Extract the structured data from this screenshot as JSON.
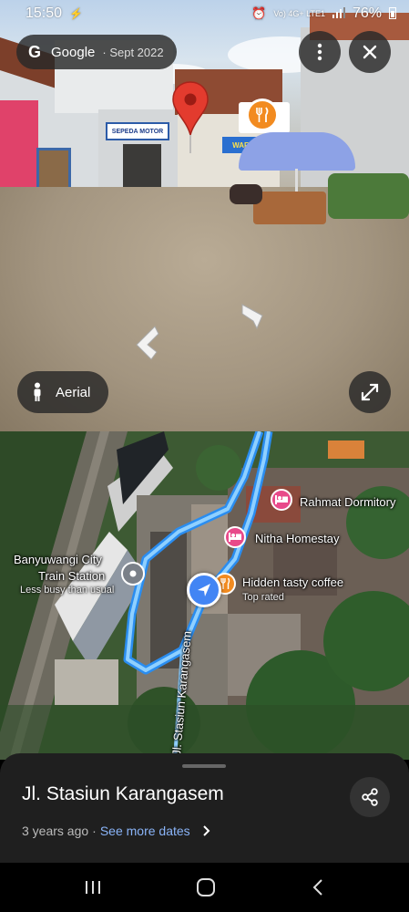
{
  "status_bar": {
    "time": "15:50",
    "network": "Vo) 4G+ LTE1",
    "battery": "76%"
  },
  "street_view": {
    "provider": "Google",
    "capture_date": "Sept 2022",
    "aerial_label": "Aerial",
    "sign_text": "SEPEDA MOTOR",
    "warung_text": "WARUNG PR",
    "icons": {
      "more": "more-vert-icon",
      "close": "close-icon",
      "expand": "expand-icon",
      "person": "person-icon",
      "pin": "red-location-pin-icon",
      "restaurant": "restaurant-icon"
    }
  },
  "map": {
    "places": [
      {
        "name": "Banyuwangi City Train Station",
        "line1": "Banyuwangi City",
        "line2": "Train Station",
        "note": "Less busy than usual",
        "icon": "train-station-icon"
      },
      {
        "name": "Rahmat Dormitory",
        "icon": "hotel-icon"
      },
      {
        "name": "Nitha Homestay",
        "icon": "hotel-icon"
      },
      {
        "name": "Hidden tasty coffee",
        "note": "Top rated",
        "icon": "coffee-icon"
      }
    ],
    "road_label": "Jl. Stasiun Karangasem",
    "colors": {
      "route": "#4aa8ff",
      "location": "#4285f4",
      "hotel": "#e84a8a",
      "food": "#f28b20"
    }
  },
  "sheet": {
    "street_name": "Jl. Stasiun Karangasem",
    "age": "3 years ago",
    "separator": "·",
    "see_more": "See more dates",
    "share_icon": "share-icon"
  }
}
